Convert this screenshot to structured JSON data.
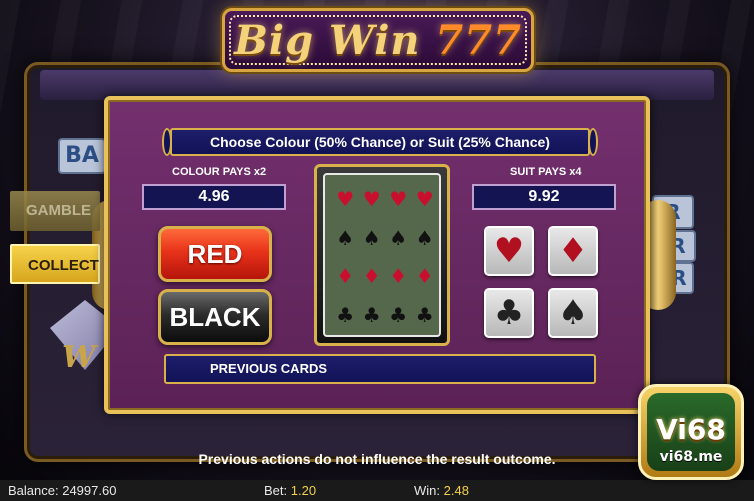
{
  "logo": {
    "title": "Big Win",
    "sevens": "777"
  },
  "side_buttons": {
    "gamble": "GAMBLE",
    "collect": "COLLECT"
  },
  "background": {
    "reel_symbol_left": "BA",
    "reel_symbol_right_1": "R",
    "reel_symbol_right_2": "R",
    "reel_symbol_right_3": "R"
  },
  "gamble": {
    "banner": "Choose Colour (50% Chance) or Suit (25% Chance)",
    "colour_pays_label": "COLOUR PAYS x2",
    "colour_pays_value": "4.96",
    "suit_pays_label": "SUIT PAYS x4",
    "suit_pays_value": "9.92",
    "red_button": "RED",
    "black_button": "BLACK",
    "suits": [
      {
        "name": "hearts",
        "glyph": "♥"
      },
      {
        "name": "diamonds",
        "glyph": "♦"
      },
      {
        "name": "clubs",
        "glyph": "♣"
      },
      {
        "name": "spades",
        "glyph": "♠"
      }
    ],
    "previous_cards_label": "PREVIOUS CARDS"
  },
  "card_back_pattern": [
    "♥",
    "♥",
    "♥",
    "♥",
    "♠",
    "♠",
    "♠",
    "♠",
    "♦",
    "♦",
    "♦",
    "♦",
    "♣",
    "♣",
    "♣",
    "♣"
  ],
  "notice": "Previous actions do not influence the result outcome.",
  "status": {
    "balance_label": "Balance:",
    "balance_value": "24997.60",
    "bet_label": "Bet:",
    "bet_value": "1.20",
    "win_label": "Win:",
    "win_value": "2.48"
  },
  "watermark": {
    "brand": "Vi68",
    "url": "vi68.me"
  },
  "colors": {
    "panel": "#6a2a66",
    "gold": "#e8c15a",
    "navy": "#141452",
    "red": "#e8321a",
    "value_yellow": "#f2d04a"
  }
}
